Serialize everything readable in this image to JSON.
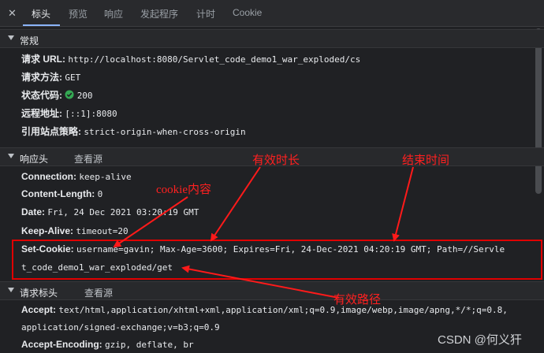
{
  "tabs": {
    "close": "✕",
    "items": [
      "标头",
      "预览",
      "响应",
      "发起程序",
      "计时",
      "Cookie"
    ]
  },
  "general": {
    "title": "常规",
    "url_key": "请求 URL:",
    "url_val": "http://localhost:8080/Servlet_code_demo1_war_exploded/cs",
    "method_key": "请求方法:",
    "method_val": "GET",
    "status_key": "状态代码:",
    "status_val": "200",
    "remote_key": "远程地址:",
    "remote_val": "[::1]:8080",
    "policy_key": "引用站点策略:",
    "policy_val": "strict-origin-when-cross-origin"
  },
  "response": {
    "title": "响应头",
    "view_source": "查看源",
    "connection_key": "Connection:",
    "connection_val": "keep-alive",
    "length_key": "Content-Length:",
    "length_val": "0",
    "date_key": "Date:",
    "date_val": "Fri, 24 Dec 2021 03:20:19 GMT",
    "keepalive_key": "Keep-Alive:",
    "keepalive_val": "timeout=20",
    "setcookie_key": "Set-Cookie:",
    "setcookie_val_1": "username=gavin; Max-Age=3600; Expires=Fri, 24-Dec-2021 04:20:19 GMT; Path=//Servle",
    "setcookie_val_2": "t_code_demo1_war_exploded/get"
  },
  "request": {
    "title": "请求标头",
    "view_source": "查看源",
    "accept_key": "Accept:",
    "accept_val_1": "text/html,application/xhtml+xml,application/xml;q=0.9,image/webp,image/apng,*/*;q=0.8,",
    "accept_val_2": "application/signed-exchange;v=b3;q=0.9",
    "encoding_key": "Accept-Encoding:",
    "encoding_val": "gzip, deflate, br"
  },
  "annotations": {
    "cookie_content": "cookie内容",
    "max_age": "有效时长",
    "end_time": "结束时间",
    "path": "有效路径"
  },
  "watermark": "CSDN @何义犴",
  "colors": {
    "annotation": "#ff2020",
    "status_ok": "#34a853",
    "tab_active": "#8ab4f8"
  }
}
